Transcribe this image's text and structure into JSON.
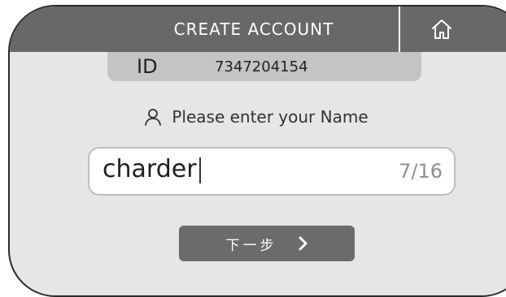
{
  "header": {
    "title": "CREATE ACCOUNT",
    "home_icon": "home-icon"
  },
  "account": {
    "id_label": "ID",
    "id_value": "7347204154"
  },
  "prompt": {
    "icon": "user-icon",
    "text": "Please enter your Name"
  },
  "name_input": {
    "value": "charder",
    "count": "7/16"
  },
  "next_button": {
    "label": "下一步",
    "icon": "chevron-right-icon"
  },
  "colors": {
    "header_bg": "#686868",
    "screen_bg": "#e6e6e7",
    "id_bar_bg": "#c4c4c5",
    "button_bg": "#6b6b6b"
  }
}
